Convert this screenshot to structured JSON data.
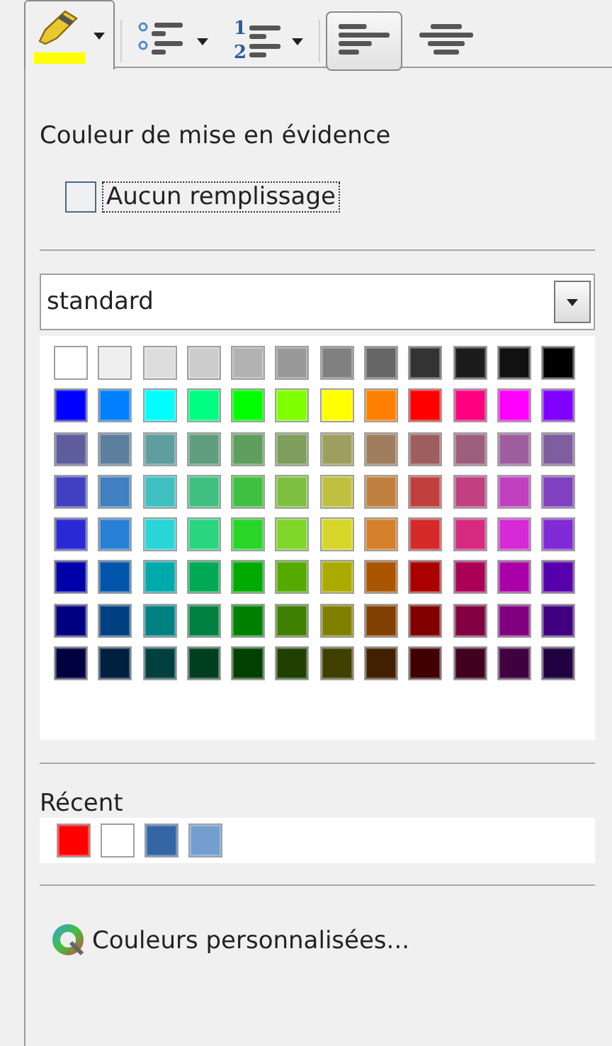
{
  "toolbar": [
    {
      "kind": "highlight",
      "selected": true,
      "color": "#ffff00"
    },
    {
      "kind": "bullets",
      "selected": false
    },
    {
      "kind": "numbering",
      "selected": false,
      "digits": [
        "1",
        "2"
      ]
    },
    {
      "kind": "align-left",
      "selected": true
    },
    {
      "kind": "align-center",
      "selected": false
    }
  ],
  "popup": {
    "title": "Couleur de mise en évidence",
    "no_fill": {
      "label": "Aucun remplissage",
      "checked": false
    },
    "palette_select": {
      "value": "standard"
    },
    "palette": [
      [
        {
          "color": "#ffffff"
        },
        {
          "color": "#eeeeee"
        },
        {
          "color": "#dddddd"
        },
        {
          "color": "#cccccc"
        },
        {
          "color": "#b2b2b2"
        },
        {
          "color": "#999999"
        },
        {
          "color": "#808080"
        },
        {
          "color": "#666666"
        },
        {
          "color": "#333333"
        },
        {
          "color": "#1c1c1c"
        },
        {
          "color": "#111111"
        },
        {
          "color": "#000000"
        }
      ],
      [
        {
          "color": "#0000ff"
        },
        {
          "color": "#0080ff"
        },
        {
          "color": "#00ffff"
        },
        {
          "color": "#00ff80"
        },
        {
          "color": "#00ff00"
        },
        {
          "color": "#80ff00"
        },
        {
          "color": "#ffff00"
        },
        {
          "color": "#ff8000"
        },
        {
          "color": "#ff0000"
        },
        {
          "color": "#ff0080"
        },
        {
          "color": "#ff00ff"
        },
        {
          "color": "#8000ff"
        }
      ],
      [
        {
          "color": "#5e5e9e"
        },
        {
          "color": "#5e7e9e"
        },
        {
          "color": "#5e9e9e"
        },
        {
          "color": "#5e9e7e"
        },
        {
          "color": "#5e9e5e"
        },
        {
          "color": "#7e9e5e"
        },
        {
          "color": "#9e9e5e"
        },
        {
          "color": "#9e7e5e"
        },
        {
          "color": "#9e5e5e"
        },
        {
          "color": "#9e5e7e"
        },
        {
          "color": "#9e5e9e"
        },
        {
          "color": "#7e5e9e"
        }
      ],
      [
        {
          "color": "#4040c0"
        },
        {
          "color": "#4080c0"
        },
        {
          "color": "#40c0c0"
        },
        {
          "color": "#40c080"
        },
        {
          "color": "#40c040"
        },
        {
          "color": "#80c040"
        },
        {
          "color": "#c0c040"
        },
        {
          "color": "#c08040"
        },
        {
          "color": "#c04040"
        },
        {
          "color": "#c04080"
        },
        {
          "color": "#c040c0"
        },
        {
          "color": "#8040c0"
        }
      ],
      [
        {
          "color": "#2a2ad5"
        },
        {
          "color": "#2a80d5"
        },
        {
          "color": "#2ad5d5"
        },
        {
          "color": "#2ad580"
        },
        {
          "color": "#2ad52a"
        },
        {
          "color": "#80d52a"
        },
        {
          "color": "#d5d52a"
        },
        {
          "color": "#d5802a"
        },
        {
          "color": "#d52a2a"
        },
        {
          "color": "#d52a80"
        },
        {
          "color": "#d52ad5"
        },
        {
          "color": "#802ad5"
        }
      ],
      [
        {
          "color": "#0000aa"
        },
        {
          "color": "#0055aa"
        },
        {
          "color": "#00aaaa"
        },
        {
          "color": "#00aa55"
        },
        {
          "color": "#00aa00"
        },
        {
          "color": "#55aa00"
        },
        {
          "color": "#aaaa00"
        },
        {
          "color": "#aa5500"
        },
        {
          "color": "#aa0000"
        },
        {
          "color": "#aa0055"
        },
        {
          "color": "#aa00aa"
        },
        {
          "color": "#5500aa"
        }
      ],
      [
        {
          "color": "#000080"
        },
        {
          "color": "#004080"
        },
        {
          "color": "#008080"
        },
        {
          "color": "#008040"
        },
        {
          "color": "#008000"
        },
        {
          "color": "#408000"
        },
        {
          "color": "#808000"
        },
        {
          "color": "#804000"
        },
        {
          "color": "#800000"
        },
        {
          "color": "#800040"
        },
        {
          "color": "#800080"
        },
        {
          "color": "#400080"
        }
      ],
      [
        {
          "color": "#000040"
        },
        {
          "color": "#002040"
        },
        {
          "color": "#004040"
        },
        {
          "color": "#004020"
        },
        {
          "color": "#004000"
        },
        {
          "color": "#204000"
        },
        {
          "color": "#404000"
        },
        {
          "color": "#402000"
        },
        {
          "color": "#400000"
        },
        {
          "color": "#400020"
        },
        {
          "color": "#400040"
        },
        {
          "color": "#200040"
        }
      ]
    ],
    "recent_label": "Récent",
    "recent": [
      {
        "color": "#ff0000"
      },
      {
        "color": "#ffffff"
      },
      {
        "color": "#3465a4"
      },
      {
        "color": "#729fcf"
      }
    ],
    "custom_colors": "Couleurs personnalisées..."
  }
}
